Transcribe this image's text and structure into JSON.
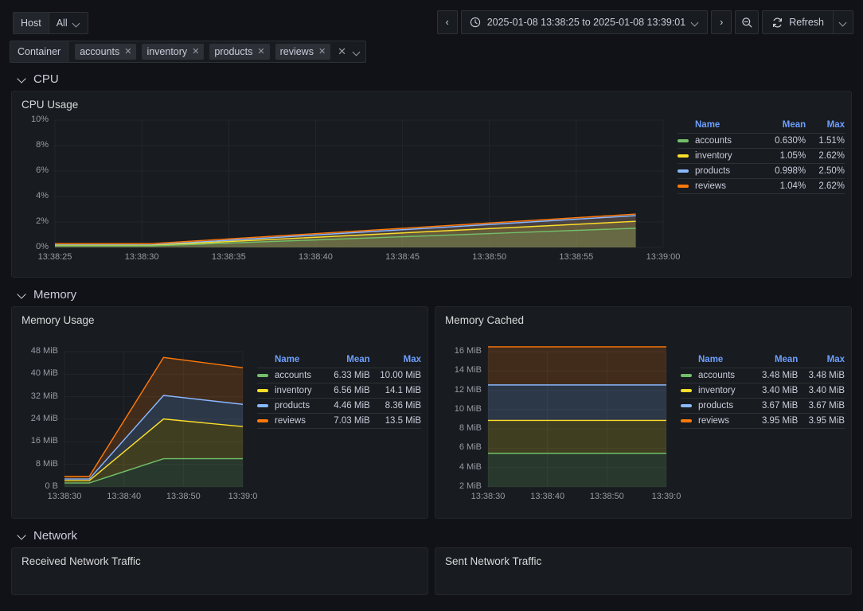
{
  "variables": {
    "host": {
      "label": "Host",
      "value": "All"
    },
    "container": {
      "label": "Container",
      "chips": [
        "accounts",
        "inventory",
        "products",
        "reviews"
      ],
      "chip_remove": "✕",
      "clear_all": "✕"
    }
  },
  "timepicker": {
    "prev": "‹",
    "next": "›",
    "range": "2025-01-08 13:38:25 to 2025-01-08 13:39:01",
    "refresh_label": "Refresh"
  },
  "sections": [
    {
      "title": "CPU"
    },
    {
      "title": "Memory"
    },
    {
      "title": "Network"
    }
  ],
  "colors": {
    "accounts": "#73BF69",
    "inventory": "#FADE2A",
    "products": "#8AB8FF",
    "reviews": "#FF780A",
    "page_bg": "#111217",
    "panel_bg": "#181b1f",
    "legend_header": "#6e9fff"
  },
  "panels": {
    "cpu_usage": {
      "title": "CPU Usage"
    },
    "memory_usage": {
      "title": "Memory Usage"
    },
    "memory_cached": {
      "title": "Memory Cached"
    },
    "received_network": {
      "title": "Received Network Traffic"
    },
    "sent_network": {
      "title": "Sent Network Traffic"
    }
  },
  "legend_headers": {
    "name": "Name",
    "mean": "Mean",
    "max": "Max"
  },
  "chart_data": [
    {
      "id": "cpu_usage",
      "type": "line",
      "title": "CPU Usage",
      "xlabel": "",
      "ylabel": "",
      "ylim": [
        0,
        10
      ],
      "yunit": "%",
      "yticks": [
        "0%",
        "2%",
        "4%",
        "6%",
        "8%",
        "10%"
      ],
      "ytick_values": [
        0,
        2,
        4,
        6,
        8,
        10
      ],
      "xticks": [
        "13:38:25",
        "13:38:30",
        "13:38:35",
        "13:38:40",
        "13:38:45",
        "13:38:50",
        "13:38:55",
        "13:39:00"
      ],
      "grid": true,
      "legend_position": "right",
      "stacked": false,
      "x": [
        0,
        6,
        36
      ],
      "series": [
        {
          "name": "accounts",
          "color": "#73BF69",
          "mean": "0.630%",
          "max": "1.51%",
          "values": [
            0.12,
            0.12,
            1.51
          ]
        },
        {
          "name": "inventory",
          "color": "#FADE2A",
          "mean": "1.05%",
          "max": "2.62%",
          "values": [
            0.16,
            0.16,
            2.05
          ]
        },
        {
          "name": "products",
          "color": "#8AB8FF",
          "mean": "0.998%",
          "max": "2.50%",
          "values": [
            0.2,
            0.2,
            2.5
          ]
        },
        {
          "name": "reviews",
          "color": "#FF780A",
          "mean": "1.04%",
          "max": "2.62%",
          "values": [
            0.3,
            0.3,
            2.62
          ]
        }
      ]
    },
    {
      "id": "memory_usage",
      "type": "area",
      "title": "Memory Usage",
      "xlabel": "",
      "ylabel": "",
      "ylim": [
        0,
        48
      ],
      "yunit": "MiB",
      "yticks": [
        "0 B",
        "8 MiB",
        "16 MiB",
        "24 MiB",
        "32 MiB",
        "40 MiB",
        "48 MiB"
      ],
      "ytick_values": [
        0,
        8,
        16,
        24,
        32,
        40,
        48
      ],
      "xticks": [
        "13:38:30",
        "13:38:40",
        "13:38:50",
        "13:39:0"
      ],
      "grid": true,
      "stacked": true,
      "legend_position": "right",
      "x": [
        0,
        5,
        20,
        36
      ],
      "series": [
        {
          "name": "accounts",
          "color": "#73BF69",
          "mean": "6.33 MiB",
          "max": "10.00 MiB",
          "values": [
            1.4,
            1.4,
            10.0,
            10.0
          ]
        },
        {
          "name": "inventory",
          "color": "#FADE2A",
          "mean": "6.56 MiB",
          "max": "14.1 MiB",
          "values": [
            0.8,
            0.8,
            14.1,
            11.4
          ]
        },
        {
          "name": "products",
          "color": "#8AB8FF",
          "mean": "4.46 MiB",
          "max": "8.36 MiB",
          "values": [
            0.6,
            0.6,
            8.36,
            7.9
          ]
        },
        {
          "name": "reviews",
          "color": "#FF780A",
          "mean": "7.03 MiB",
          "max": "13.5 MiB",
          "values": [
            0.9,
            0.9,
            13.5,
            13.0
          ]
        }
      ]
    },
    {
      "id": "memory_cached",
      "type": "area",
      "title": "Memory Cached",
      "xlabel": "",
      "ylabel": "",
      "ylim": [
        2,
        16
      ],
      "yunit": "MiB",
      "yticks": [
        "2 MiB",
        "4 MiB",
        "6 MiB",
        "8 MiB",
        "10 MiB",
        "12 MiB",
        "14 MiB",
        "16 MiB"
      ],
      "ytick_values": [
        2,
        4,
        6,
        8,
        10,
        12,
        14,
        16
      ],
      "xticks": [
        "13:38:30",
        "13:38:40",
        "13:38:50",
        "13:39:0"
      ],
      "grid": true,
      "stacked": true,
      "legend_position": "right",
      "x": [
        0,
        36
      ],
      "series": [
        {
          "name": "accounts",
          "color": "#73BF69",
          "mean": "3.48 MiB",
          "max": "3.48 MiB",
          "values": [
            3.48,
            3.48
          ]
        },
        {
          "name": "inventory",
          "color": "#FADE2A",
          "mean": "3.40 MiB",
          "max": "3.40 MiB",
          "values": [
            3.4,
            3.4
          ]
        },
        {
          "name": "products",
          "color": "#8AB8FF",
          "mean": "3.67 MiB",
          "max": "3.67 MiB",
          "values": [
            3.67,
            3.67
          ]
        },
        {
          "name": "reviews",
          "color": "#FF780A",
          "mean": "3.95 MiB",
          "max": "3.95 MiB",
          "values": [
            3.95,
            3.95
          ]
        }
      ]
    }
  ]
}
